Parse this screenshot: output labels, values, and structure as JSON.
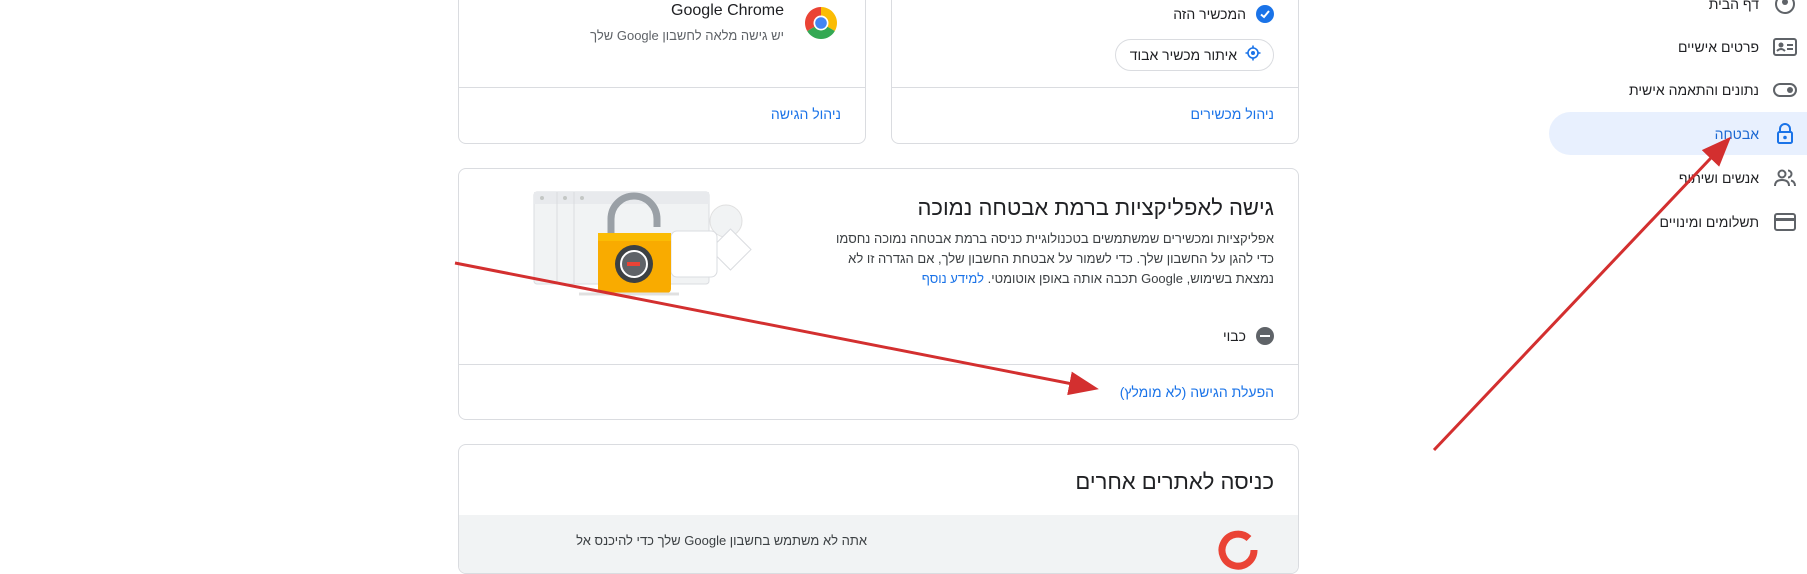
{
  "nav": {
    "items": [
      {
        "label": "דף הבית",
        "icon": "home-icon",
        "active": false
      },
      {
        "label": "פרטים אישיים",
        "icon": "id-card-icon",
        "active": false
      },
      {
        "label": "נתונים והתאמה אישית",
        "icon": "toggle-icon",
        "active": false
      },
      {
        "label": "אבטחה",
        "icon": "lock-icon",
        "active": true
      },
      {
        "label": "אנשים ושיתוף",
        "icon": "people-icon",
        "active": false
      },
      {
        "label": "תשלומים ומינויים",
        "icon": "credit-card-icon",
        "active": false
      }
    ]
  },
  "devices_card": {
    "this_device": "המכשיר הזה",
    "find_device_button": "איתור מכשיר אבוד",
    "manage_link": "ניהול מכשירים"
  },
  "apps_card": {
    "app_name": "Google Chrome",
    "app_desc": "יש גישה מלאה לחשבון Google שלך",
    "manage_link": "ניהול הגישה"
  },
  "less_secure_card": {
    "title": "גישה לאפליקציות ברמת אבטחה נמוכה",
    "desc": "אפליקציות ומכשירים שמשתמשים בטכנולוגיית כניסה ברמת אבטחה נמוכה נחסמו כדי להגן על החשבון שלך. כדי לשמור על אבטחת החשבון שלך, אם הגדרה זו לא נמצאת בשימוש, Google תכבה אותה באופן אוטומטי.",
    "learn_more": "למידע נוסף",
    "status": "כבוי",
    "enable_link": "הפעלת הגישה (לא מומלץ)"
  },
  "other_sites_card": {
    "title": "כניסה לאתרים אחרים",
    "row_text": "אתה לא משתמש בחשבון Google שלך כדי להיכנס אל"
  },
  "colors": {
    "accent": "#1a73e8",
    "active_nav_bg": "#e8f0fe",
    "annotation_arrow": "#d32f2f"
  }
}
